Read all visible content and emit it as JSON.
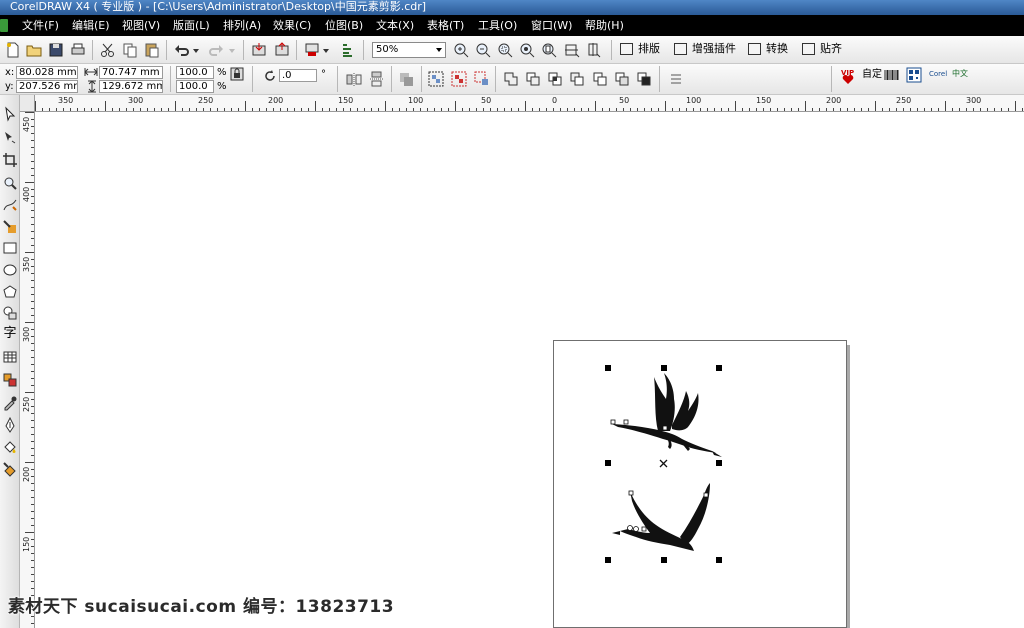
{
  "window": {
    "title": "CorelDRAW X4 ( 专业版 ) - [C:\\Users\\Administrator\\Desktop\\中国元素剪影.cdr]"
  },
  "menu": [
    "文件(F)",
    "编辑(E)",
    "视图(V)",
    "版面(L)",
    "排列(A)",
    "效果(C)",
    "位图(B)",
    "文本(X)",
    "表格(T)",
    "工具(O)",
    "窗口(W)",
    "帮助(H)"
  ],
  "standard_toolbar": {
    "zoom_value": "50%"
  },
  "plugins": {
    "layout": "排版",
    "enhance": "增强插件",
    "convert": "转换",
    "snap": "贴齐"
  },
  "property_bar": {
    "x_label": "x:",
    "x_value": "80.028 mm",
    "y_label": "y:",
    "y_value": "207.526 mm",
    "width_value": "70.747 mm",
    "height_value": "129.672 mm",
    "scale_x": "100.0",
    "scale_y": "100.0",
    "percent": "%",
    "rotation_value": ".0",
    "degree": "°",
    "vip_label": "VIP",
    "auto_label": "自定",
    "corel_label": "Corel",
    "chinese_label": "中文"
  },
  "rulers": {
    "horizontal": [
      "350",
      "300",
      "250",
      "200",
      "150",
      "100",
      "50",
      "0",
      "50",
      "100",
      "150",
      "200",
      "250",
      "300"
    ],
    "vertical": [
      "450",
      "400",
      "350",
      "300",
      "250",
      "200",
      "150"
    ]
  },
  "toolbox": {
    "text_tool_label": "字"
  },
  "watermark": {
    "text": "素材天下 sucaisucai.com  编号：13823713"
  },
  "colors": {
    "titlebar": "#2a5a96",
    "menubar": "#000000",
    "page_shadow": "#a9a9a9"
  }
}
